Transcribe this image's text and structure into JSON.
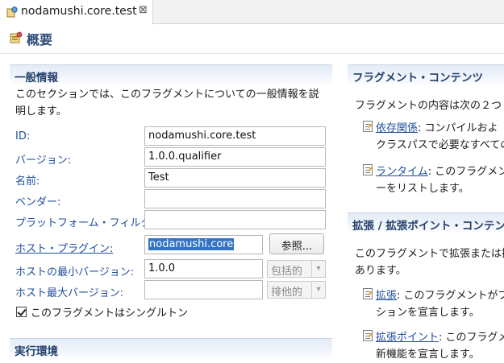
{
  "tab": {
    "title": "nodamushi.core.test",
    "close_glyph": "⊠"
  },
  "header": {
    "title": "概要"
  },
  "general": {
    "title": "一般情報",
    "desc_line1": "このセクションでは、このフラグメントについての一般情報を説",
    "desc_line2": "明します。",
    "id_label": "ID:",
    "id_value": "nodamushi.core.test",
    "version_label": "バージョン:",
    "version_value": "1.0.0.qualifier",
    "name_label": "名前:",
    "name_value": "Test",
    "vendor_label": "ベンダー:",
    "vendor_value": "",
    "platform_label": "プラットフォーム・フィルター:",
    "platform_value": "",
    "host_label": "ホスト・プラグイン:",
    "host_value": "nodamushi.core",
    "browse_label": "参照...",
    "min_label": "ホストの最小バージョン:",
    "min_value": "1.0.0",
    "min_combo": "包括的",
    "max_label": "ホスト最大バージョン:",
    "max_value": "",
    "max_combo": "排他的",
    "singleton_label": "このフラグメントはシングルトン",
    "singleton_checked": true
  },
  "runtime": {
    "title": "実行環境"
  },
  "contents": {
    "title": "フラグメント・コンテンツ",
    "intro": "フラグメントの内容は次の２つ",
    "dep_link": "依存関係",
    "dep_text1": ": コンパイルおよ",
    "dep_text2": "クラスパスで必要なすべての",
    "rt_link": "ランタイム",
    "rt_text1": ": このフラグメントの",
    "rt_text2": "ーをリストします。"
  },
  "extensions": {
    "title": "拡張 / 拡張ポイント・コンテンツ",
    "intro1": "このフラグメントで拡張または拡",
    "intro2": "あります。",
    "ext_link": "拡張",
    "ext_text1": ": このフラグメントがプ",
    "ext_text2": "ションを宣言します。",
    "extp_link": "拡張ポイント",
    "extp_text1": ": このフラグメン",
    "extp_text2": "新機能を宣言します。"
  }
}
